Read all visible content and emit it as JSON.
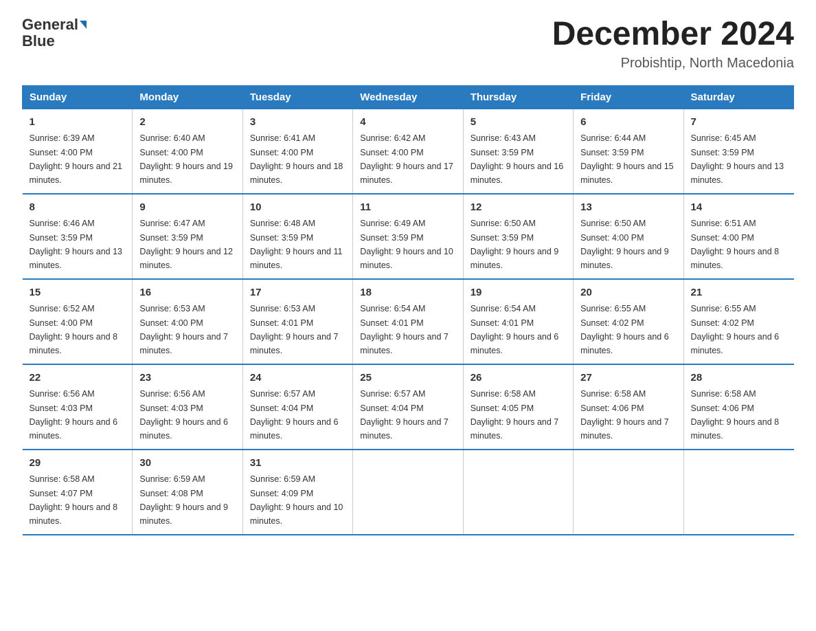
{
  "header": {
    "logo_top": "General",
    "logo_bottom": "Blue",
    "title": "December 2024",
    "subtitle": "Probishtip, North Macedonia"
  },
  "days_of_week": [
    "Sunday",
    "Monday",
    "Tuesday",
    "Wednesday",
    "Thursday",
    "Friday",
    "Saturday"
  ],
  "weeks": [
    [
      {
        "day": "1",
        "sunrise": "6:39 AM",
        "sunset": "4:00 PM",
        "daylight": "9 hours and 21 minutes."
      },
      {
        "day": "2",
        "sunrise": "6:40 AM",
        "sunset": "4:00 PM",
        "daylight": "9 hours and 19 minutes."
      },
      {
        "day": "3",
        "sunrise": "6:41 AM",
        "sunset": "4:00 PM",
        "daylight": "9 hours and 18 minutes."
      },
      {
        "day": "4",
        "sunrise": "6:42 AM",
        "sunset": "4:00 PM",
        "daylight": "9 hours and 17 minutes."
      },
      {
        "day": "5",
        "sunrise": "6:43 AM",
        "sunset": "3:59 PM",
        "daylight": "9 hours and 16 minutes."
      },
      {
        "day": "6",
        "sunrise": "6:44 AM",
        "sunset": "3:59 PM",
        "daylight": "9 hours and 15 minutes."
      },
      {
        "day": "7",
        "sunrise": "6:45 AM",
        "sunset": "3:59 PM",
        "daylight": "9 hours and 13 minutes."
      }
    ],
    [
      {
        "day": "8",
        "sunrise": "6:46 AM",
        "sunset": "3:59 PM",
        "daylight": "9 hours and 13 minutes."
      },
      {
        "day": "9",
        "sunrise": "6:47 AM",
        "sunset": "3:59 PM",
        "daylight": "9 hours and 12 minutes."
      },
      {
        "day": "10",
        "sunrise": "6:48 AM",
        "sunset": "3:59 PM",
        "daylight": "9 hours and 11 minutes."
      },
      {
        "day": "11",
        "sunrise": "6:49 AM",
        "sunset": "3:59 PM",
        "daylight": "9 hours and 10 minutes."
      },
      {
        "day": "12",
        "sunrise": "6:50 AM",
        "sunset": "3:59 PM",
        "daylight": "9 hours and 9 minutes."
      },
      {
        "day": "13",
        "sunrise": "6:50 AM",
        "sunset": "4:00 PM",
        "daylight": "9 hours and 9 minutes."
      },
      {
        "day": "14",
        "sunrise": "6:51 AM",
        "sunset": "4:00 PM",
        "daylight": "9 hours and 8 minutes."
      }
    ],
    [
      {
        "day": "15",
        "sunrise": "6:52 AM",
        "sunset": "4:00 PM",
        "daylight": "9 hours and 8 minutes."
      },
      {
        "day": "16",
        "sunrise": "6:53 AM",
        "sunset": "4:00 PM",
        "daylight": "9 hours and 7 minutes."
      },
      {
        "day": "17",
        "sunrise": "6:53 AM",
        "sunset": "4:01 PM",
        "daylight": "9 hours and 7 minutes."
      },
      {
        "day": "18",
        "sunrise": "6:54 AM",
        "sunset": "4:01 PM",
        "daylight": "9 hours and 7 minutes."
      },
      {
        "day": "19",
        "sunrise": "6:54 AM",
        "sunset": "4:01 PM",
        "daylight": "9 hours and 6 minutes."
      },
      {
        "day": "20",
        "sunrise": "6:55 AM",
        "sunset": "4:02 PM",
        "daylight": "9 hours and 6 minutes."
      },
      {
        "day": "21",
        "sunrise": "6:55 AM",
        "sunset": "4:02 PM",
        "daylight": "9 hours and 6 minutes."
      }
    ],
    [
      {
        "day": "22",
        "sunrise": "6:56 AM",
        "sunset": "4:03 PM",
        "daylight": "9 hours and 6 minutes."
      },
      {
        "day": "23",
        "sunrise": "6:56 AM",
        "sunset": "4:03 PM",
        "daylight": "9 hours and 6 minutes."
      },
      {
        "day": "24",
        "sunrise": "6:57 AM",
        "sunset": "4:04 PM",
        "daylight": "9 hours and 6 minutes."
      },
      {
        "day": "25",
        "sunrise": "6:57 AM",
        "sunset": "4:04 PM",
        "daylight": "9 hours and 7 minutes."
      },
      {
        "day": "26",
        "sunrise": "6:58 AM",
        "sunset": "4:05 PM",
        "daylight": "9 hours and 7 minutes."
      },
      {
        "day": "27",
        "sunrise": "6:58 AM",
        "sunset": "4:06 PM",
        "daylight": "9 hours and 7 minutes."
      },
      {
        "day": "28",
        "sunrise": "6:58 AM",
        "sunset": "4:06 PM",
        "daylight": "9 hours and 8 minutes."
      }
    ],
    [
      {
        "day": "29",
        "sunrise": "6:58 AM",
        "sunset": "4:07 PM",
        "daylight": "9 hours and 8 minutes."
      },
      {
        "day": "30",
        "sunrise": "6:59 AM",
        "sunset": "4:08 PM",
        "daylight": "9 hours and 9 minutes."
      },
      {
        "day": "31",
        "sunrise": "6:59 AM",
        "sunset": "4:09 PM",
        "daylight": "9 hours and 10 minutes."
      },
      null,
      null,
      null,
      null
    ]
  ]
}
